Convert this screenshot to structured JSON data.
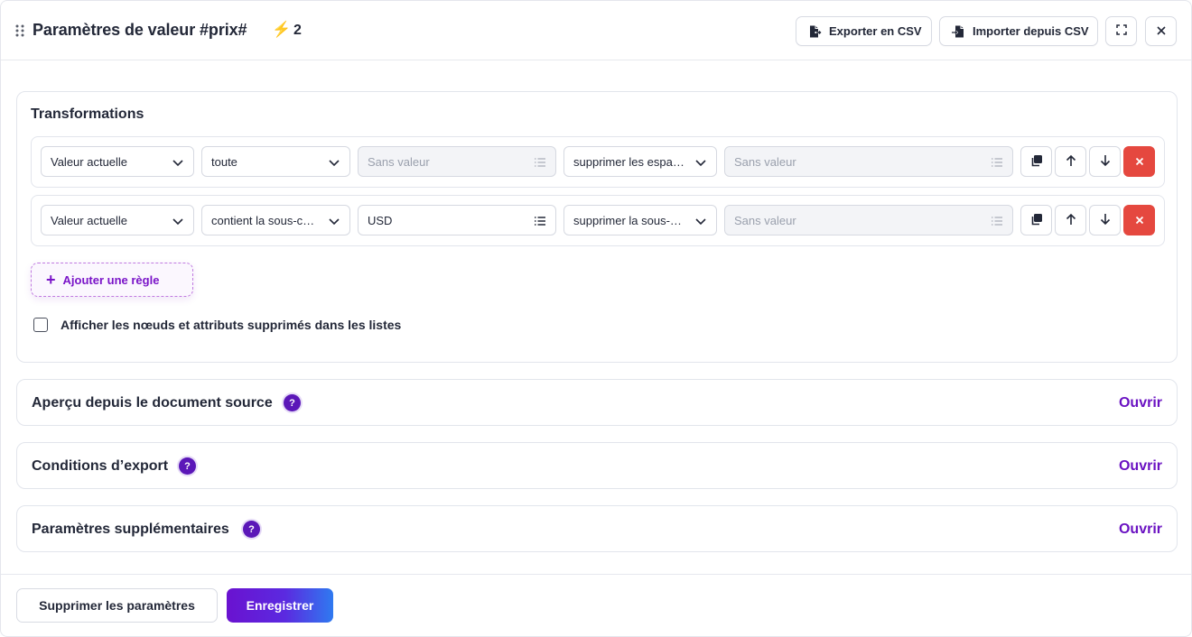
{
  "header": {
    "title": "Paramètres de valeur #prix#",
    "bolt_icon": "lightning-icon",
    "bolt_count": "2",
    "export_label": "Exporter en CSV",
    "import_label": "Importer depuis CSV"
  },
  "transformations": {
    "title": "Transformations",
    "rows": [
      {
        "source": "Valeur actuelle",
        "condition": "toute",
        "condition_value": "Sans valeur",
        "condition_value_state": "disabled",
        "action": "supprimer les espa…",
        "action_value": "Sans valeur"
      },
      {
        "source": "Valeur actuelle",
        "condition": "contient la sous-c…",
        "condition_value": "USD",
        "condition_value_state": "filled",
        "action": "supprimer la sous-…",
        "action_value": "Sans valeur"
      }
    ],
    "add_rule_label": "Ajouter une règle",
    "checkbox_label": "Afficher les nœuds et attributs supprimés dans les listes",
    "checkbox_checked": false
  },
  "sections": [
    {
      "title": "Aperçu depuis le document source",
      "help": "?",
      "open_label": "Ouvrir"
    },
    {
      "title": "Conditions d’export",
      "help": "?",
      "open_label": "Ouvrir"
    },
    {
      "title": "Paramètres supplémentaires",
      "help": "?",
      "open_label": "Ouvrir"
    }
  ],
  "footer": {
    "delete_label": "Supprimer les paramètres",
    "save_label": "Enregistrer"
  },
  "colors": {
    "accent": "#6a12c2",
    "danger": "#e5483f",
    "bolt": "#f5b400"
  }
}
